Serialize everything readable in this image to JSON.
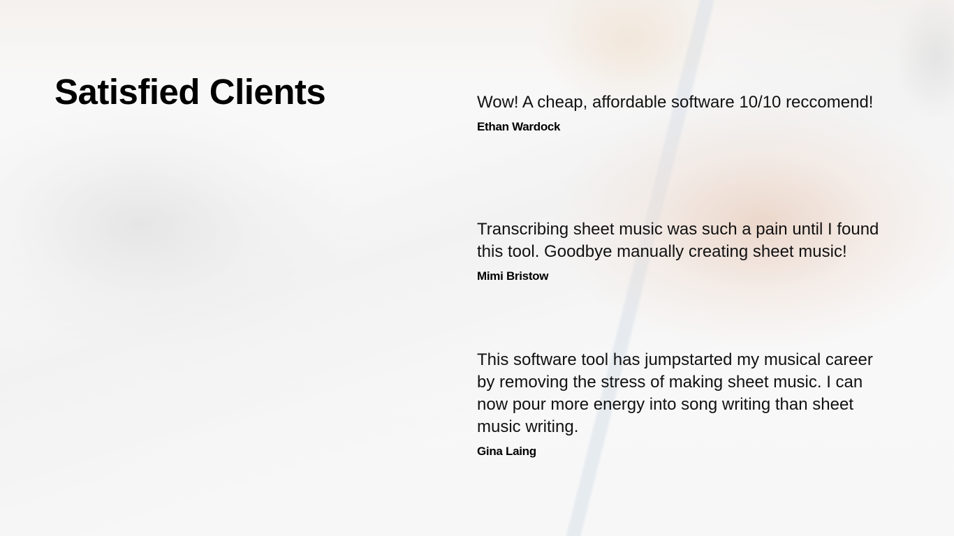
{
  "title": "Satisfied Clients",
  "testimonials": [
    {
      "quote": "Wow! A cheap, affordable software 10/10 reccomend!",
      "name": "Ethan Wardock"
    },
    {
      "quote": "Transcribing sheet music was such a pain until I found this tool. Goodbye manually creating sheet music!",
      "name": "Mimi Bristow"
    },
    {
      "quote": "This software tool has jumpstarted my musical career by removing the stress of making sheet music. I can now pour more energy into song writing than sheet music writing.",
      "name": "Gina Laing"
    }
  ]
}
